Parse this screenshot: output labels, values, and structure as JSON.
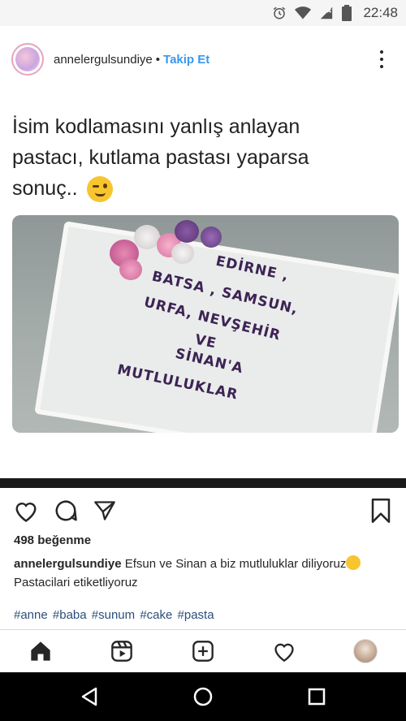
{
  "status_bar": {
    "time": "22:48",
    "icons": [
      "alarm-icon",
      "wifi-icon",
      "signal-icon",
      "battery-icon"
    ]
  },
  "post": {
    "username": "annelergulsundiye",
    "separator": "•",
    "follow_label": "Takip Et",
    "media": {
      "text_lines": [
        "İsim kodlamasını yanlış anlayan",
        "pastacı, kutlama pastası yaparsa",
        "sonuç.."
      ],
      "cake_lines": [
        "EDİRNE ,",
        "BATSA , SAMSUN,",
        "URFA, NEVŞEHİR",
        "VE",
        "SİNAN'A",
        "MUTLULUKLAR"
      ]
    },
    "likes": "498 beğenme",
    "caption_user": "annelergulsundiye",
    "caption_text": " Efsun ve Sinan a biz mutluluklar diliyoruz",
    "caption_text_2": "Pastacilari etiketliyoruz",
    "hashtags": [
      "#anne",
      "#baba",
      "#sunum",
      "#cake",
      "#pasta"
    ]
  },
  "bottom_nav": [
    "home-icon",
    "reels-icon",
    "add-post-icon",
    "activity-heart-icon",
    "profile-avatar"
  ],
  "android_nav": [
    "back-icon",
    "home-circle-icon",
    "recents-icon"
  ],
  "colors": {
    "accent_blue": "#3897f0",
    "hashtag": "#003569",
    "text": "#262626",
    "cake_text": "#3d2355"
  }
}
